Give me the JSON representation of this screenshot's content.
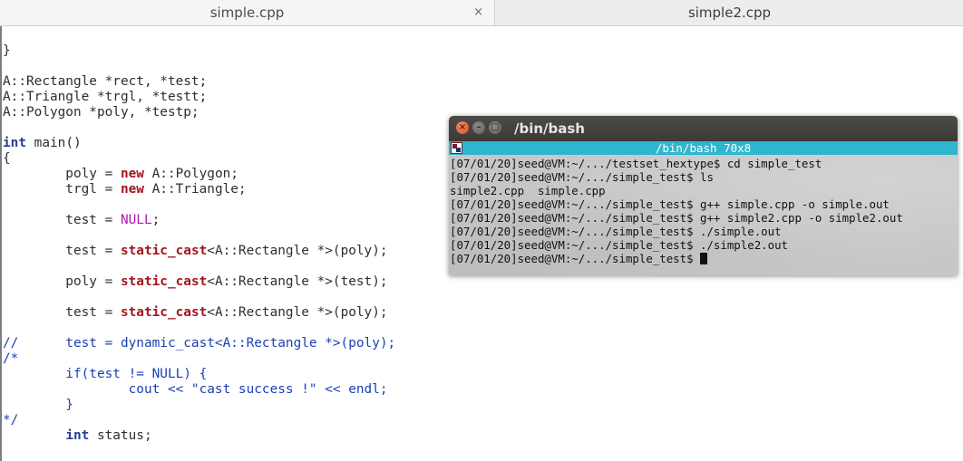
{
  "tabs": [
    {
      "label": "simple.cpp",
      "close": "×"
    },
    {
      "label": "simple2.cpp"
    }
  ],
  "editor": {
    "lines": [
      "};",
      "",
      "}",
      "",
      "A::Rectangle *rect, *test;",
      "A::Triangle *trgl, *testt;",
      "A::Polygon *poly, *testp;",
      "",
      "int main()",
      "{",
      "        poly = new A::Polygon;",
      "        trgl = new A::Triangle;",
      "",
      "        test = NULL;",
      "",
      "        test = static_cast<A::Rectangle *>(poly);",
      "",
      "        poly = static_cast<A::Rectangle *>(test);",
      "",
      "        test = static_cast<A::Rectangle *>(poly);",
      "",
      "//      test = dynamic_cast<A::Rectangle *>(poly);",
      "/*",
      "        if(test != NULL) {",
      "                cout << \"cast success !\" << endl;",
      "        }",
      "*/",
      "        int status;"
    ]
  },
  "terminal": {
    "title": "/bin/bash",
    "status_text": "/bin/bash 70x8",
    "lines": [
      "[07/01/20]seed@VM:~/.../testset_hextype$ cd simple_test",
      "[07/01/20]seed@VM:~/.../simple_test$ ls",
      "simple2.cpp  simple.cpp",
      "[07/01/20]seed@VM:~/.../simple_test$ g++ simple.cpp -o simple.out",
      "[07/01/20]seed@VM:~/.../simple_test$ g++ simple2.cpp -o simple2.out",
      "[07/01/20]seed@VM:~/.../simple_test$ ./simple.out",
      "[07/01/20]seed@VM:~/.../simple_test$ ./simple2.out"
    ],
    "prompt": "[07/01/20]seed@VM:~/.../simple_test$ ",
    "buttons": {
      "close": "×",
      "minimize": "–",
      "maximize": "□"
    }
  }
}
